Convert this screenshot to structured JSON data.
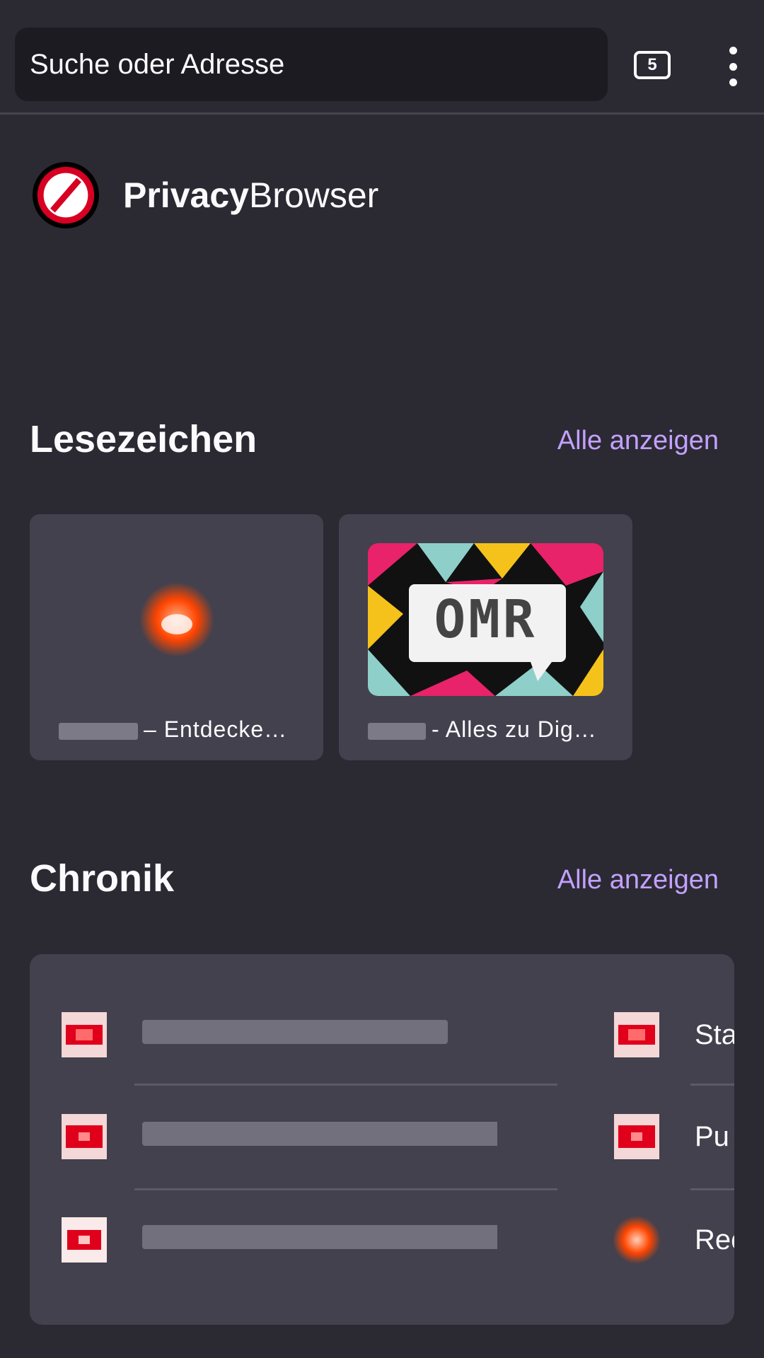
{
  "toolbar": {
    "url_placeholder": "Suche oder Adresse",
    "tab_count": "5",
    "menu_icon": "more-vertical-icon"
  },
  "brand": {
    "name_bold": "Privacy",
    "name_regular": "Browser",
    "logo_icon": "no-entry-sign-icon"
  },
  "bookmarks": {
    "title": "Lesezeichen",
    "show_all": "Alle anzeigen",
    "items": [
      {
        "title": "– Entdecke…",
        "icon": "reddit-icon"
      },
      {
        "title": "- Alles zu Dig…",
        "thumbnail_text": "OMR"
      }
    ]
  },
  "history": {
    "title": "Chronik",
    "show_all": "Alle anzeigen",
    "right_column": [
      "Sta",
      "Pu",
      "Rec"
    ]
  },
  "colors": {
    "background": "#2b2a33",
    "card": "#42414d",
    "url_bar": "#1c1b22",
    "accent_link": "#c3a1ff"
  }
}
